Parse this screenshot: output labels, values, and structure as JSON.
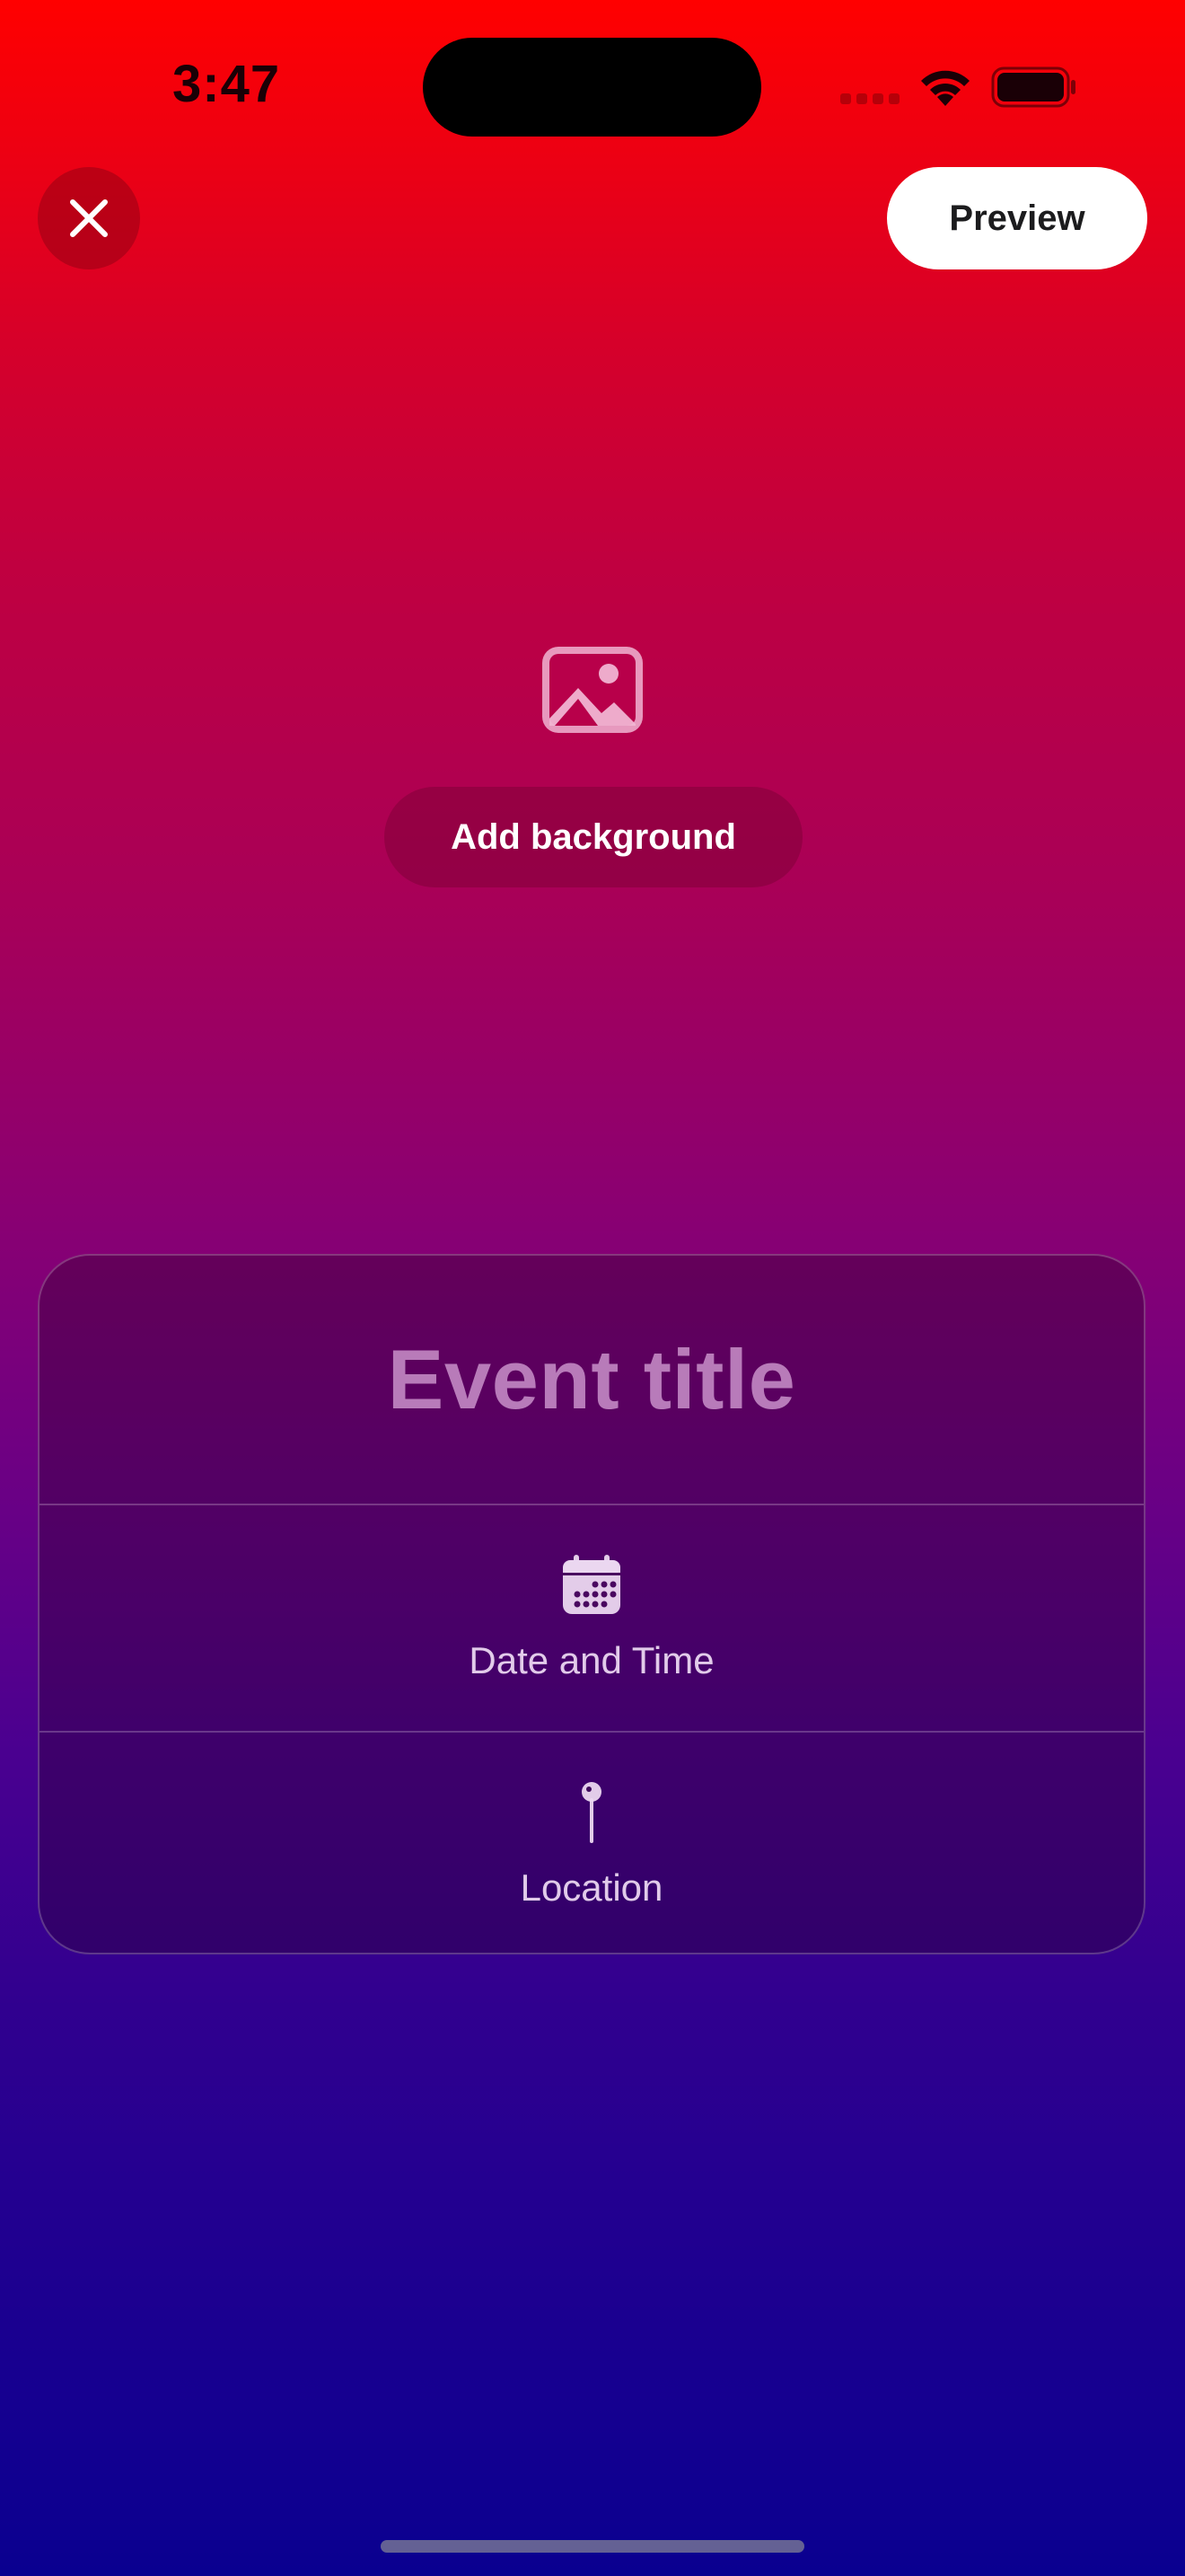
{
  "status_bar": {
    "time": "3:47"
  },
  "top_bar": {
    "close_icon": "close-icon",
    "preview_label": "Preview"
  },
  "background": {
    "icon": "photo-icon",
    "add_label": "Add background"
  },
  "event_card": {
    "title_placeholder": "Event title",
    "date_time": {
      "icon": "calendar-icon",
      "label": "Date and Time"
    },
    "location": {
      "icon": "pin-icon",
      "label": "Location"
    }
  },
  "colors": {
    "gradient_top": "#ff0000",
    "gradient_bottom": "#0a0090",
    "preview_button": "#ffffff"
  }
}
